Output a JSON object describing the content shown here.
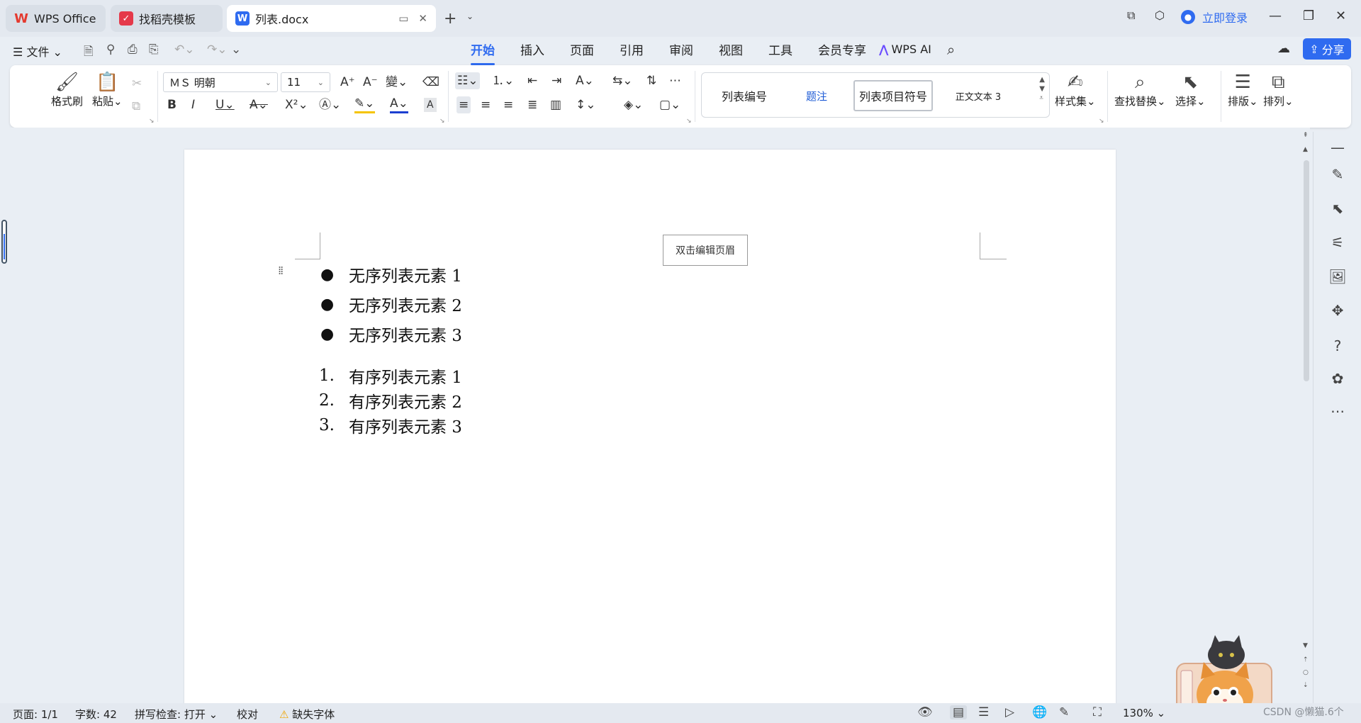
{
  "tabs": [
    {
      "label": "WPS Office",
      "icon": "wps-logo-icon"
    },
    {
      "label": "找稻壳模板",
      "icon": "daoke-logo-icon"
    },
    {
      "label": "列表.docx",
      "icon": "word-doc-icon"
    }
  ],
  "titlebar": {
    "login": "立即登录"
  },
  "menu": {
    "file": "文件",
    "tabs": [
      "开始",
      "插入",
      "页面",
      "引用",
      "审阅",
      "视图",
      "工具",
      "会员专享"
    ],
    "active_tab": "开始",
    "ai": "WPS AI",
    "share": "分享"
  },
  "ribbon": {
    "format_painter": "格式刷",
    "paste": "粘贴",
    "font_name": "ＭＳ 明朝",
    "font_size": "11",
    "styles": [
      "列表编号",
      "题注",
      "列表项目符号",
      "正文文本 3"
    ],
    "selected_style": "列表项目符号",
    "style_set": "样式集",
    "find_replace": "查找替换",
    "select": "选择",
    "layout": "排版",
    "arrange": "排列"
  },
  "document": {
    "header_hint": "双击编辑页眉",
    "unordered": [
      "无序列表元素 1",
      "无序列表元素 2",
      "无序列表元素 3"
    ],
    "ordered": [
      {
        "num": "1.",
        "text": "有序列表元素 1"
      },
      {
        "num": "2.",
        "text": "有序列表元素 2"
      },
      {
        "num": "3.",
        "text": "有序列表元素 3"
      }
    ]
  },
  "status": {
    "page": "页面: 1/1",
    "words": "字数: 42",
    "spell": "拼写检查: 打开",
    "proof": "校对",
    "missing_font": "缺失字体",
    "zoom": "130%",
    "watermark": "CSDN @懒猫.6个"
  },
  "colors": {
    "accent": "#2f6bf0",
    "font_color_bar": "#1c3fd0",
    "highlight_bar": "#f5c400"
  }
}
